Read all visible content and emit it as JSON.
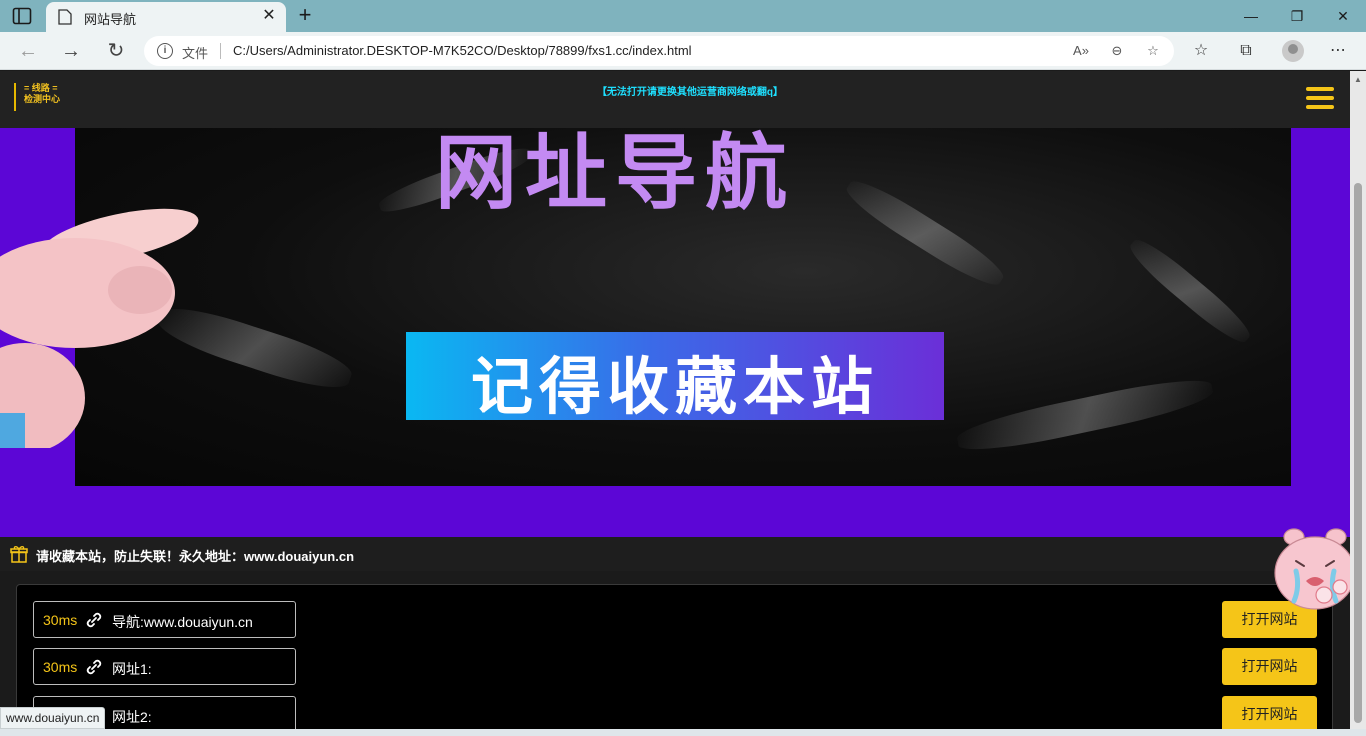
{
  "browser": {
    "tab_title": "网站导航",
    "url_scheme_label": "文件",
    "url": "C:/Users/Administrator.DESKTOP-M7K52CO/Desktop/78899/fxs1.cc/index.html",
    "status_url": "www.douaiyun.cn"
  },
  "header": {
    "logo_line1": "= 线路 =",
    "logo_line2": "检测中心",
    "notice": "【无法打开请更换其他运营商网络或翻q】"
  },
  "banner": {
    "title": "网址导航",
    "bookmark": "记得收藏本站"
  },
  "announcement": {
    "text": "请收藏本站，防止失联！永久地址：www.douaiyun.cn"
  },
  "links": [
    {
      "latency": "30ms",
      "name": "导航:www.douaiyun.cn",
      "button": "打开网站"
    },
    {
      "latency": "30ms",
      "name": "网址1:",
      "button": "打开网站"
    },
    {
      "latency": "",
      "name": "网址2:",
      "button": "打开网站"
    }
  ],
  "colors": {
    "accent": "#f5c518",
    "banner_bg": "#5c06d6",
    "notice": "#1ee0ff",
    "title": "#c38af2"
  }
}
